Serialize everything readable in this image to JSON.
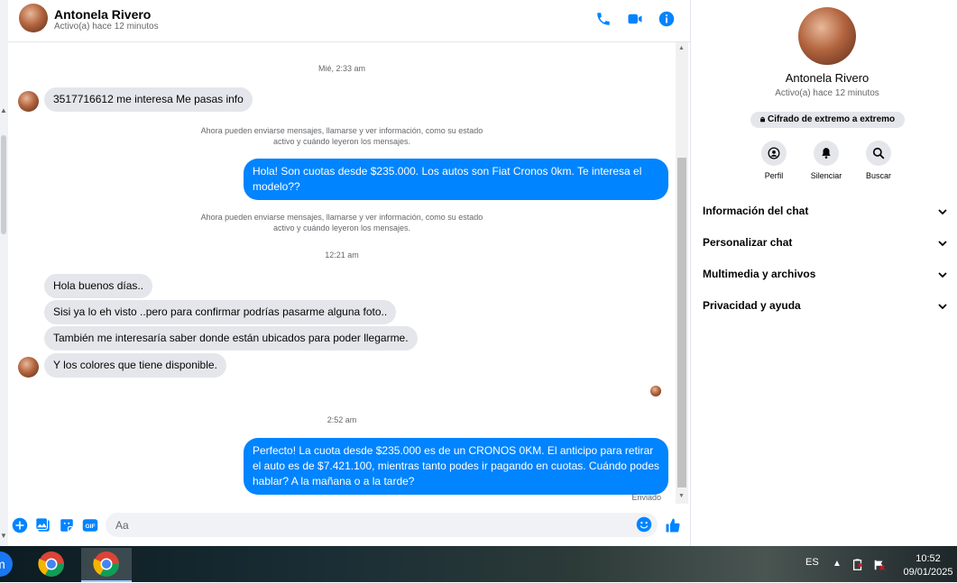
{
  "header": {
    "name": "Antonela Rivero",
    "status": "Activo(a) hace 12 minutos",
    "icons": [
      "phone-icon",
      "video-icon",
      "info-icon"
    ]
  },
  "conversation": {
    "timestamps": [
      "Mié, 2:33 am",
      "12:21 am",
      "2:52 am"
    ],
    "system_notice_line1": "Ahora pueden enviarse mensajes, llamarse y ver información, como su estado",
    "system_notice_line2": "activo y cuándo leyeron los mensajes.",
    "messages": [
      {
        "from": "in",
        "text": "3517716612 me interesa Me pasas info"
      },
      {
        "from": "out",
        "text": "Hola! Son cuotas desde $235.000. Los autos son Fiat Cronos 0km. Te interesa el modelo??"
      },
      {
        "from": "in",
        "text": "Hola buenos días.."
      },
      {
        "from": "in",
        "text": "Sisi ya lo eh visto ..pero para confirmar podrías pasarme alguna foto.."
      },
      {
        "from": "in",
        "text": "También me interesaría saber donde están ubicados para poder llegarme."
      },
      {
        "from": "in",
        "text": "Y los colores que tiene disponible."
      },
      {
        "from": "out",
        "text": "Perfecto! La cuota desde $235.000 es de un CRONOS 0KM. El anticipo para retirar el auto es de $7.421.100, mientras tanto podes ir pagando en cuotas. Cuándo podes hablar? A la mañana o a la tarde?"
      }
    ],
    "sent_status": "Enviado"
  },
  "composer": {
    "placeholder": "Aa",
    "icons": [
      "plus-icon",
      "image-icon",
      "sticker-icon",
      "gif-icon",
      "emoji-icon",
      "like-icon"
    ],
    "gif_label": "GIF"
  },
  "info_panel": {
    "name": "Antonela Rivero",
    "status": "Activo(a) hace 12 minutos",
    "encryption_badge": "Cifrado de extremo a extremo",
    "actions": [
      {
        "label": "Perfil",
        "icon": "profile-icon"
      },
      {
        "label": "Silenciar",
        "icon": "bell-icon"
      },
      {
        "label": "Buscar",
        "icon": "search-icon"
      }
    ],
    "sections": [
      {
        "label": "Información del chat"
      },
      {
        "label": "Personalizar chat"
      },
      {
        "label": "Multimedia y archivos"
      },
      {
        "label": "Privacidad y ayuda"
      }
    ]
  },
  "taskbar": {
    "language": "ES",
    "time": "10:52",
    "date": "09/01/2025"
  },
  "colors": {
    "accent": "#0084ff",
    "incoming_bubble": "#e4e6eb",
    "secondary_text": "#65676b"
  }
}
